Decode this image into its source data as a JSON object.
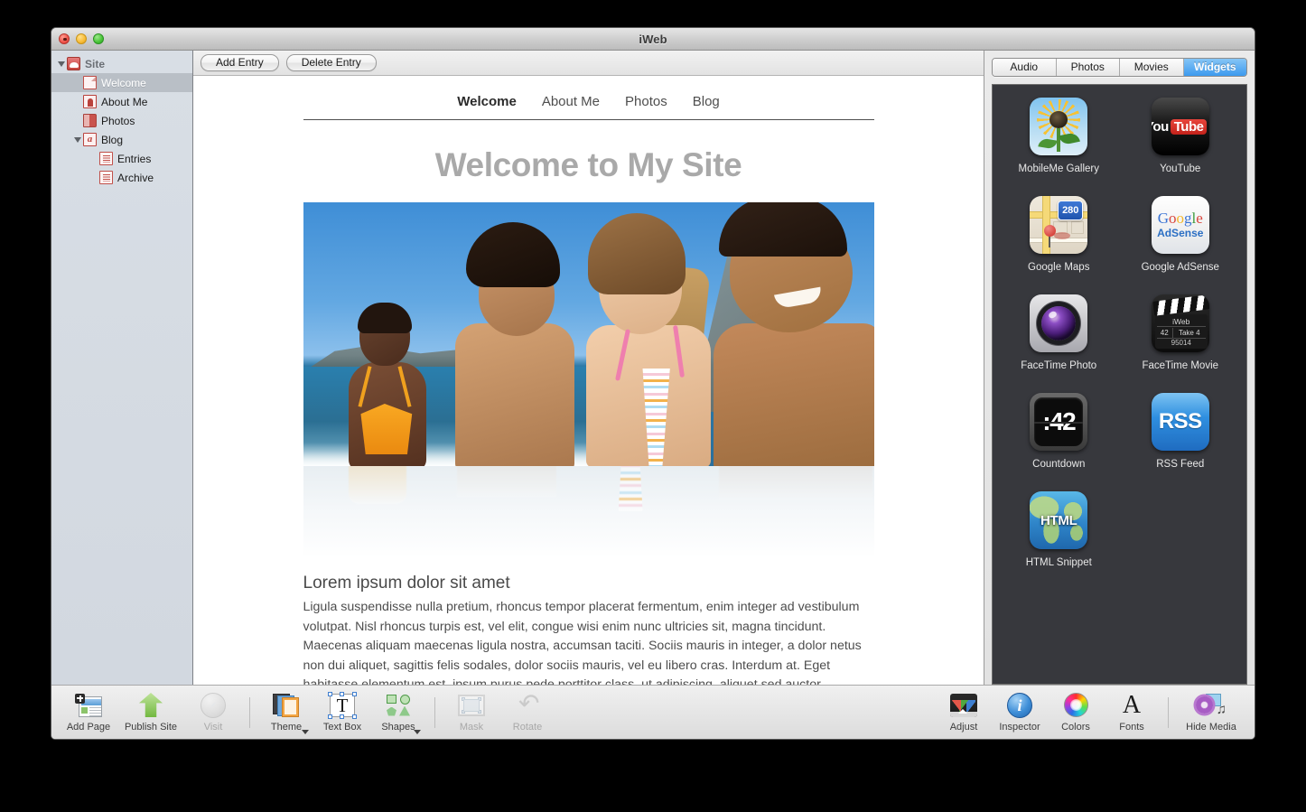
{
  "window": {
    "title": "iWeb"
  },
  "sidebar": {
    "items": [
      {
        "label": "Site",
        "icon": "site-icon",
        "level": 0,
        "disclosure": "open",
        "selected": false
      },
      {
        "label": "Welcome",
        "icon": "page-icon",
        "level": 1,
        "disclosure": "none",
        "selected": true
      },
      {
        "label": "About Me",
        "icon": "about-icon",
        "level": 1,
        "disclosure": "none",
        "selected": false
      },
      {
        "label": "Photos",
        "icon": "photos-icon",
        "level": 1,
        "disclosure": "none",
        "selected": false
      },
      {
        "label": "Blog",
        "icon": "blog-icon",
        "level": 1,
        "disclosure": "open",
        "selected": false
      },
      {
        "label": "Entries",
        "icon": "entry-icon",
        "level": 2,
        "disclosure": "none",
        "selected": false
      },
      {
        "label": "Archive",
        "icon": "entry-icon",
        "level": 2,
        "disclosure": "none",
        "selected": false
      }
    ]
  },
  "entry_bar": {
    "add_label": "Add Entry",
    "delete_label": "Delete Entry"
  },
  "page": {
    "nav": [
      {
        "label": "Welcome",
        "current": true
      },
      {
        "label": "About Me",
        "current": false
      },
      {
        "label": "Photos",
        "current": false
      },
      {
        "label": "Blog",
        "current": false
      }
    ],
    "title": "Welcome to My Site",
    "photo_alt": "Four smiling young people at the beach with mountains behind",
    "body_heading": "Lorem ipsum dolor sit amet",
    "body_text": "Ligula suspendisse nulla pretium, rhoncus tempor placerat fermentum, enim integer ad vestibulum volutpat. Nisl rhoncus turpis est, vel elit, congue wisi enim nunc ultricies sit, magna tincidunt. Maecenas aliquam maecenas ligula nostra, accumsan taciti. Sociis mauris in integer, a dolor netus non dui aliquet, sagittis felis sodales, dolor sociis mauris, vel eu libero cras. Interdum at. Eget habitasse elementum est, ipsum purus pede porttitor class, ut adipiscing, aliquet sed auctor, imperdiet arcu per diam dapibus libero duis. Enim eros in vel,"
  },
  "media_panel": {
    "tabs": [
      {
        "label": "Audio",
        "active": false
      },
      {
        "label": "Photos",
        "active": false
      },
      {
        "label": "Movies",
        "active": false
      },
      {
        "label": "Widgets",
        "active": true
      }
    ],
    "accent_color": "#3c9aee",
    "background_color": "#37383d",
    "widgets": [
      {
        "label": "MobileMe Gallery",
        "icon": "mobileme-gallery-icon"
      },
      {
        "label": "YouTube",
        "icon": "youtube-icon",
        "you": "You",
        "tube": "Tube",
        "tm": "™"
      },
      {
        "label": "Google Maps",
        "icon": "google-maps-icon",
        "shield": "280"
      },
      {
        "label": "Google AdSense",
        "icon": "google-adsense-icon",
        "brand": "Google",
        "sub": "AdSense"
      },
      {
        "label": "FaceTime Photo",
        "icon": "facetime-photo-icon"
      },
      {
        "label": "FaceTime Movie",
        "icon": "facetime-movie-icon",
        "slate_title": "iWeb",
        "slate_num": "42",
        "slate_take": "Take 4",
        "slate_code": "95014"
      },
      {
        "label": "Countdown",
        "icon": "countdown-icon",
        "display": ":42"
      },
      {
        "label": "RSS Feed",
        "icon": "rss-feed-icon",
        "badge": "RSS"
      },
      {
        "label": "HTML Snippet",
        "icon": "html-snippet-icon",
        "badge": "HTML"
      }
    ]
  },
  "toolbar": {
    "items": [
      {
        "label": "Add Page",
        "icon": "add-page-icon",
        "disabled": false,
        "menu": false
      },
      {
        "label": "Publish Site",
        "icon": "publish-site-icon",
        "disabled": false,
        "menu": false
      },
      {
        "label": "Visit",
        "icon": "visit-icon",
        "disabled": true,
        "menu": false
      },
      {
        "label": "Theme",
        "icon": "theme-icon",
        "disabled": false,
        "menu": true
      },
      {
        "label": "Text Box",
        "icon": "text-box-icon",
        "disabled": false,
        "menu": false
      },
      {
        "label": "Shapes",
        "icon": "shapes-icon",
        "disabled": false,
        "menu": true
      },
      {
        "label": "Mask",
        "icon": "mask-icon",
        "disabled": true,
        "menu": false
      },
      {
        "label": "Rotate",
        "icon": "rotate-icon",
        "disabled": true,
        "menu": false
      },
      {
        "label": "Adjust",
        "icon": "adjust-icon",
        "disabled": false,
        "menu": false
      },
      {
        "label": "Inspector",
        "icon": "inspector-icon",
        "disabled": false,
        "menu": false
      },
      {
        "label": "Colors",
        "icon": "colors-icon",
        "disabled": false,
        "menu": false
      },
      {
        "label": "Fonts",
        "icon": "fonts-icon",
        "disabled": false,
        "menu": false
      },
      {
        "label": "Hide Media",
        "icon": "hide-media-icon",
        "disabled": false,
        "menu": false
      }
    ]
  }
}
